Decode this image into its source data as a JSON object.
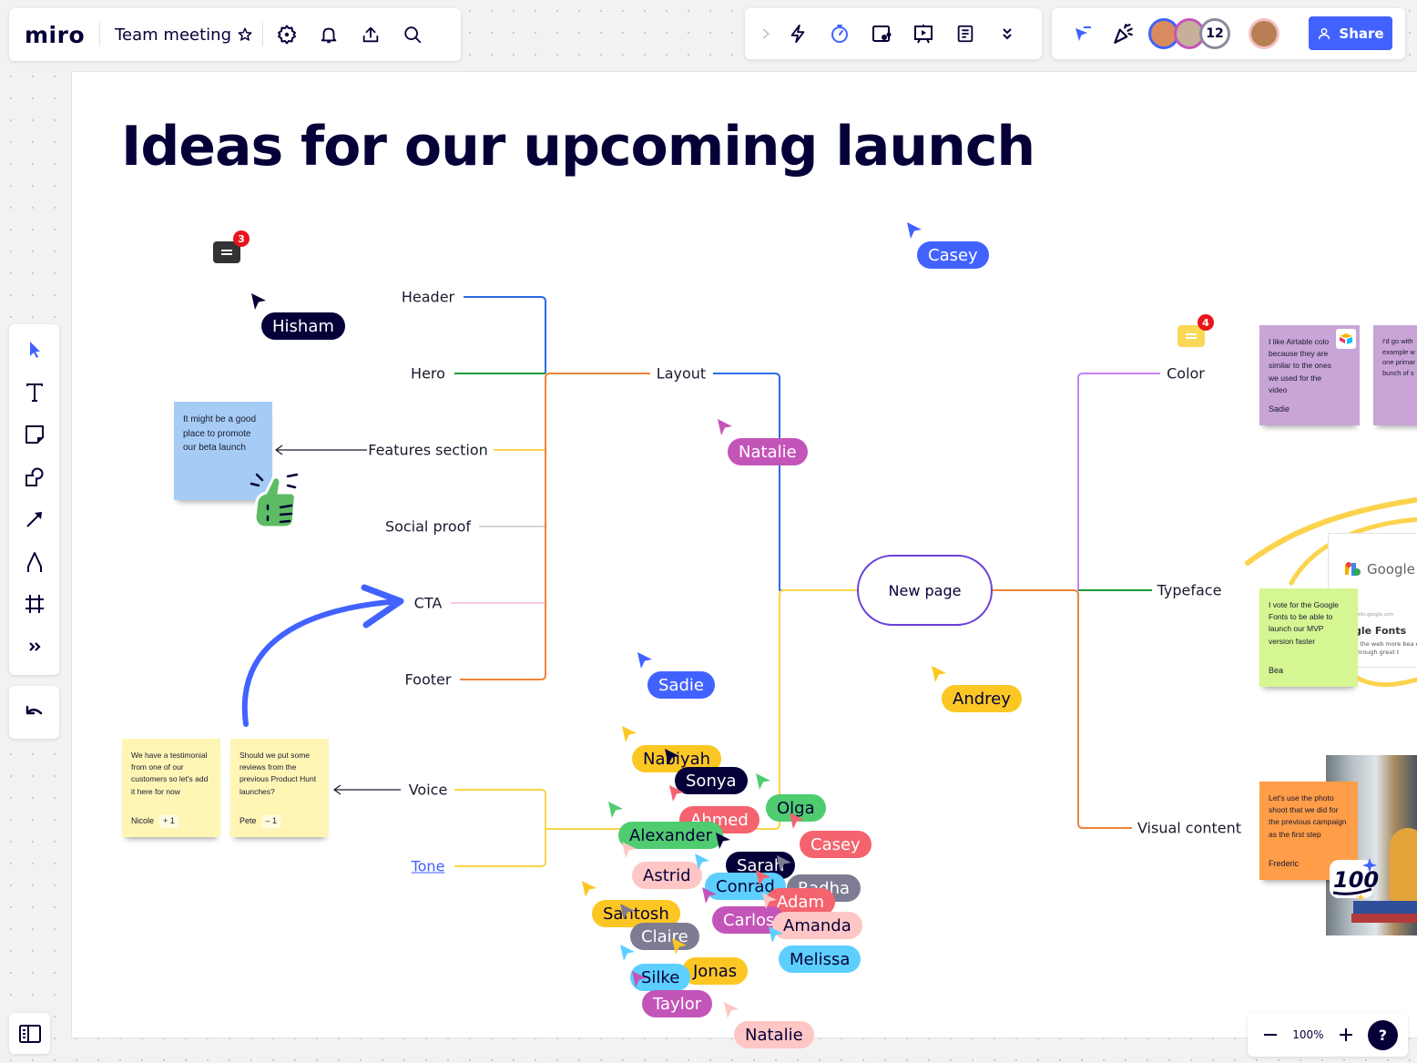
{
  "app": {
    "logo": "miro",
    "board_title": "Team meeting"
  },
  "topbar": {
    "left_icons": [
      "star-icon",
      "settings-icon",
      "bell-icon",
      "export-icon",
      "search-icon"
    ],
    "mid_icons": [
      "chevron-right-icon",
      "lightning-icon",
      "timer-icon",
      "card-icon",
      "presentation-icon",
      "notes-icon",
      "chevrons-down-icon"
    ],
    "right_icons": [
      "cursor-follow-icon",
      "celebrate-icon"
    ],
    "collaborators_extra_count": "12",
    "share_label": "Share"
  },
  "toolbar": {
    "tools": [
      "select",
      "text",
      "sticky-note",
      "shapes",
      "arrow",
      "pen",
      "frame",
      "more"
    ]
  },
  "zoom": {
    "level": "100%",
    "help": "?"
  },
  "board": {
    "title": "Ideas for our upcoming launch",
    "central_node": "New page",
    "left_branches": {
      "layout": "Layout",
      "layout_children": [
        "Header",
        "Hero",
        "Features section",
        "Social proof",
        "CTA",
        "Footer"
      ],
      "voice_children": [
        "Voice",
        "Tone"
      ]
    },
    "right_branches": [
      "Color",
      "Typeface",
      "Visual content"
    ],
    "colors": {
      "blue": "#2d6be4",
      "green": "#1a9a3a",
      "orange": "#f0833a",
      "yellow": "#fcd34d",
      "pink": "#f9c6e4",
      "gray": "#d4d7cf",
      "purple": "#c684f0",
      "central_border": "#6b3fd9"
    }
  },
  "stickies": [
    {
      "id": "beta",
      "text": "It might be a good place to promote our beta launch",
      "author": "",
      "color": "#a6ccf5"
    },
    {
      "id": "nicole",
      "text": "We have a testimonial from one of our customers so let's add it here for now",
      "author": "Nicole",
      "vote": "+ 1",
      "color": "#fff6b6"
    },
    {
      "id": "pete",
      "text": "Should we put some reviews from the previous Product Hunt launches?",
      "author": "Pete",
      "vote": "– 1",
      "color": "#fff6b6"
    },
    {
      "id": "sadie",
      "text": "I like Airtable colo because they are similar to the ones we used for the video",
      "author": "Sadie",
      "color": "#c9a4d6"
    },
    {
      "id": "purple2",
      "text": "I'd go with example w one primar bunch of s",
      "author": "",
      "color": "#c9a4d6"
    },
    {
      "id": "bea",
      "text": "I vote for the Google Fonts to be able to launch our MVP version faster",
      "author": "Bea",
      "color": "#d5f692"
    },
    {
      "id": "frederic",
      "text": "Let's use the photo shoot that we did for the previous campaign as the first step",
      "author": "Frederic",
      "color": "#ff9d48"
    }
  ],
  "comments": [
    {
      "count": "3",
      "color": "#333333"
    },
    {
      "count": "4",
      "color": "#fad857"
    }
  ],
  "google_fonts_card": {
    "brand": "Google",
    "url": "fonts.google.com",
    "heading": "gle Fonts",
    "desc": "g the web more bea en through great t"
  },
  "cursors": [
    {
      "name": "Hisham",
      "bg": "#050038",
      "fg": "#ffffff"
    },
    {
      "name": "Casey",
      "bg": "#4262ff",
      "fg": "#ffffff"
    },
    {
      "name": "Natalie",
      "bg": "#c455b8",
      "fg": "#ffffff"
    },
    {
      "name": "Sadie",
      "bg": "#4262ff",
      "fg": "#ffffff"
    },
    {
      "name": "Andrey",
      "bg": "#fcc723",
      "fg": "#050038"
    },
    {
      "name": "Nabiyah",
      "bg": "#fcc723",
      "fg": "#050038"
    },
    {
      "name": "Sonya",
      "bg": "#050038",
      "fg": "#ffffff"
    },
    {
      "name": "Olga",
      "bg": "#4fcc6f",
      "fg": "#050038"
    },
    {
      "name": "Ahmed",
      "bg": "#f4636e",
      "fg": "#ffffff"
    },
    {
      "name": "Alexander",
      "bg": "#4fcc6f",
      "fg": "#050038"
    },
    {
      "name": "Casey",
      "bg": "#f4636e",
      "fg": "#ffffff"
    },
    {
      "name": "Sarah",
      "bg": "#050038",
      "fg": "#ffffff"
    },
    {
      "name": "Astrid",
      "bg": "#ffc6c6",
      "fg": "#050038"
    },
    {
      "name": "Conrad",
      "bg": "#5ccfff",
      "fg": "#050038"
    },
    {
      "name": "Radha",
      "bg": "#7d7c93",
      "fg": "#ffffff"
    },
    {
      "name": "Adam",
      "bg": "#f4636e",
      "fg": "#ffffff"
    },
    {
      "name": "Santosh",
      "bg": "#fcc723",
      "fg": "#050038"
    },
    {
      "name": "Carlos",
      "bg": "#c455b8",
      "fg": "#ffffff"
    },
    {
      "name": "Amanda",
      "bg": "#ffc6c6",
      "fg": "#050038"
    },
    {
      "name": "Claire",
      "bg": "#7d7c93",
      "fg": "#ffffff"
    },
    {
      "name": "Melissa",
      "bg": "#5ccfff",
      "fg": "#050038"
    },
    {
      "name": "Jonas",
      "bg": "#fcc723",
      "fg": "#050038"
    },
    {
      "name": "Silke",
      "bg": "#5ccfff",
      "fg": "#050038"
    },
    {
      "name": "Taylor",
      "bg": "#c455b8",
      "fg": "#ffffff"
    },
    {
      "name": "Natalie",
      "bg": "#ffc6c6",
      "fg": "#050038"
    }
  ],
  "stickers": [
    "thumbs-up-sticker",
    "hundred-points-sticker"
  ]
}
